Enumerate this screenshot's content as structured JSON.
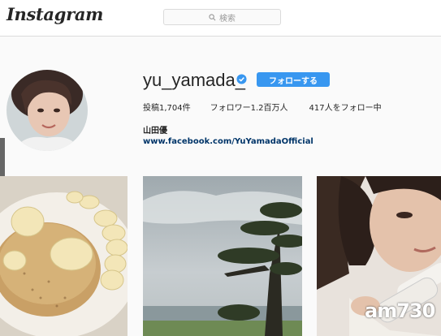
{
  "header": {
    "logo_text": "Instagram",
    "search_placeholder": "検索",
    "search_icon": "search-icon"
  },
  "profile": {
    "username": "yu_yamada_",
    "verified_icon": "verified-badge-icon",
    "follow_label": "フォローする",
    "stats": {
      "posts_label": "投稿",
      "posts_value": "1,704件",
      "followers_label": "フォロワー",
      "followers_value": "1.2百万人",
      "following_label": "417人をフォロー中"
    },
    "name": "山田優",
    "website": "www.facebook.com/YuYamadaOfficial"
  },
  "posts": [
    {
      "description_icon": "pancake-photo"
    },
    {
      "description_icon": "tree-seascape-photo"
    },
    {
      "description_icon": "selfie-product-photo"
    }
  ],
  "watermark": {
    "prefix": "am",
    "number": "730"
  },
  "colors": {
    "accent": "#3897f0",
    "link": "#003569",
    "verified": "#3897f0"
  }
}
